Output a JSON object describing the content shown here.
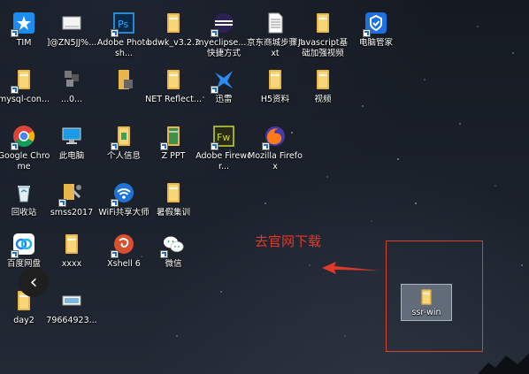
{
  "desktop": {
    "icons": [
      {
        "label": "TIM",
        "icon": "tim-icon"
      },
      {
        "label": "]@ZN5JJ%...",
        "icon": "document-icon"
      },
      {
        "label": "Adobe Photosh...",
        "icon": "photoshop-icon"
      },
      {
        "label": "bdwk_v3.2.3",
        "icon": "folder-icon"
      },
      {
        "label": "myeclipse... - 快捷方式",
        "icon": "eclipse-icon"
      },
      {
        "label": "京东商城步骤.txt",
        "icon": "text-file-icon"
      },
      {
        "label": "Javascript基础加强视频",
        "icon": "folder-icon"
      },
      {
        "label": "电脑管家",
        "icon": "pc-manager-icon"
      },
      {
        "label": "mysql-con...",
        "icon": "folder-icon"
      },
      {
        "label": "...0...",
        "icon": "blurred-icon"
      },
      {
        "label": "",
        "icon": "blurred-icon"
      },
      {
        "label": "NET Reflect...",
        "icon": "folder-icon"
      },
      {
        "label": "迅雷",
        "icon": "xunlei-icon"
      },
      {
        "label": "H5资料",
        "icon": "folder-icon"
      },
      {
        "label": "视频",
        "icon": "folder-icon"
      },
      {
        "label": "Google Chrome",
        "icon": "chrome-icon"
      },
      {
        "label": "此电脑",
        "icon": "computer-icon"
      },
      {
        "label": "个人信息",
        "icon": "folder-icon"
      },
      {
        "label": "Z PPT",
        "icon": "ppt-icon"
      },
      {
        "label": "Adobe Firewor...",
        "icon": "fireworks-icon"
      },
      {
        "label": "Mozilla Firefox",
        "icon": "firefox-icon"
      },
      {
        "label": "回收站",
        "icon": "recycle-bin-icon"
      },
      {
        "label": "smss2017",
        "icon": "sql-icon"
      },
      {
        "label": "WiFi共享大师",
        "icon": "wifi-icon"
      },
      {
        "label": "暑假集训",
        "icon": "folder-icon"
      },
      {
        "label": "百度网盘",
        "icon": "baidu-netdisk-icon"
      },
      {
        "label": "xxxx",
        "icon": "folder-icon"
      },
      {
        "label": "Xshell 6",
        "icon": "xshell-icon"
      },
      {
        "label": "微信",
        "icon": "wechat-icon"
      },
      {
        "label": "day2",
        "icon": "folder-icon"
      },
      {
        "label": "79664923...",
        "icon": "image-file-icon"
      }
    ],
    "selected_icon": {
      "label": "ssr-win",
      "icon": "folder-icon"
    }
  },
  "annotation": {
    "text": "去官网下载",
    "color": "#e0392b"
  },
  "back_button": {
    "glyph": "‹"
  }
}
